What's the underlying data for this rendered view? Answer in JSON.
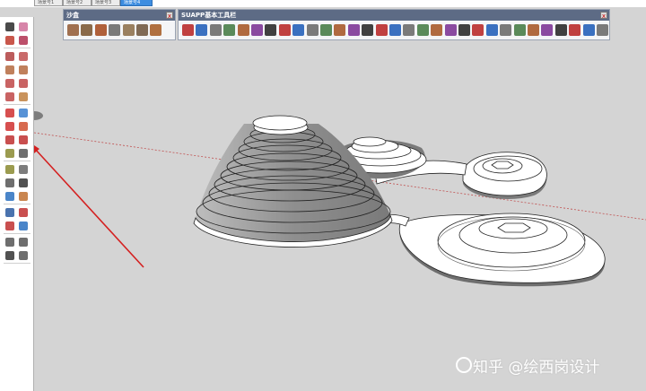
{
  "scene_tabs": [
    "场景号1",
    "场景号2",
    "场景号3",
    "场景号4"
  ],
  "active_tab_index": 3,
  "toolbars": {
    "sandbox": {
      "title": "沙盒",
      "close": "x",
      "icon_count": 7
    },
    "suapp": {
      "title": "SUAPP基本工具栏",
      "close": "x",
      "icon_count": 31
    }
  },
  "left_tools": [
    {
      "name": "select-icon",
      "color": "#2a2a2a"
    },
    {
      "name": "eraser-icon",
      "color": "#d0709a"
    },
    {
      "name": "pencil-icon",
      "color": "#c0392b"
    },
    {
      "name": "freehand-icon",
      "color": "#b03050"
    },
    {
      "name": "rectangle-icon",
      "color": "#b04040"
    },
    {
      "name": "rotated-rectangle-icon",
      "color": "#c05050"
    },
    {
      "name": "circle-icon",
      "color": "#b56a40"
    },
    {
      "name": "polygon-icon",
      "color": "#b56a40"
    },
    {
      "name": "arc-icon",
      "color": "#c04848"
    },
    {
      "name": "pie-icon",
      "color": "#c04848"
    },
    {
      "name": "three-point-arc-icon",
      "color": "#c04848"
    },
    {
      "name": "two-point-arc-icon",
      "color": "#c08040"
    },
    {
      "name": "move-icon",
      "color": "#d03030"
    },
    {
      "name": "push-pull-icon",
      "color": "#3a7fcf"
    },
    {
      "name": "rotate-icon",
      "color": "#d03030"
    },
    {
      "name": "follow-me-icon",
      "color": "#d05030"
    },
    {
      "name": "scale-icon",
      "color": "#c03030"
    },
    {
      "name": "offset-icon",
      "color": "#c03030"
    },
    {
      "name": "tape-measure-icon",
      "color": "#8a8a30"
    },
    {
      "name": "dimension-icon",
      "color": "#555555"
    },
    {
      "name": "protractor-icon",
      "color": "#8a8a30"
    },
    {
      "name": "text-icon",
      "color": "#666666"
    },
    {
      "name": "axes-icon",
      "color": "#555555"
    },
    {
      "name": "3d-text-icon",
      "color": "#333333"
    },
    {
      "name": "orbit-icon",
      "color": "#2a70c0"
    },
    {
      "name": "pan-icon",
      "color": "#c07030"
    },
    {
      "name": "zoom-icon",
      "color": "#2a5aa0"
    },
    {
      "name": "zoom-window-icon",
      "color": "#c03030"
    },
    {
      "name": "zoom-extents-icon",
      "color": "#c03030"
    },
    {
      "name": "previous-view-icon",
      "color": "#2a70c0"
    },
    {
      "name": "position-camera-icon",
      "color": "#555555"
    },
    {
      "name": "look-around-icon",
      "color": "#555555"
    },
    {
      "name": "walk-icon",
      "color": "#333333"
    },
    {
      "name": "section-plane-icon",
      "color": "#555555"
    }
  ],
  "watermark": "知乎 @绘西岗设计"
}
